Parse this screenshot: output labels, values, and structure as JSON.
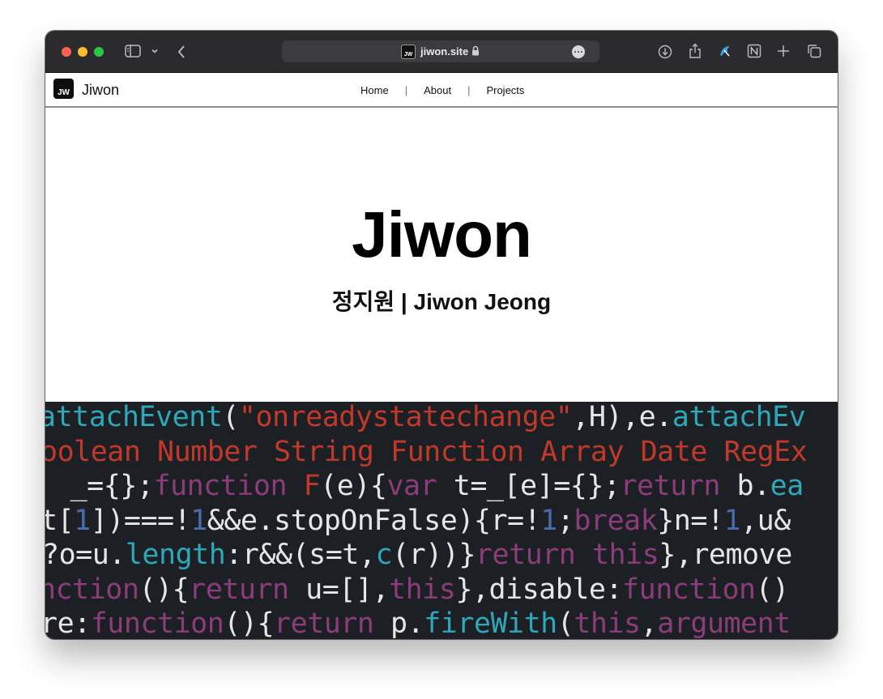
{
  "browser": {
    "url": "jiwon.site",
    "favicon_text": "JW",
    "colors": {
      "toolbar": "#2b2b2d",
      "close": "#ff5f57",
      "minimize": "#febc2e",
      "zoom": "#28c840"
    },
    "icons": [
      "sidebar-icon",
      "chevron-down-icon",
      "back-icon",
      "lock-icon",
      "more-icon",
      "download-icon",
      "share-icon",
      "extension-icon",
      "notion-icon",
      "plus-icon",
      "tabs-icon"
    ]
  },
  "site": {
    "logo_text": "JW",
    "brand": "Jiwon",
    "nav": [
      {
        "label": "Home"
      },
      {
        "label": "About"
      },
      {
        "label": "Projects"
      }
    ],
    "nav_separator": "|"
  },
  "hero": {
    "title": "Jiwon",
    "subtitle": "정지원 | Jiwon Jeong"
  },
  "code_banner": {
    "lines": [
      [
        [
          "teal",
          "attachEvent"
        ],
        [
          "white",
          "("
        ],
        [
          "red",
          "\"onreadystatechange\""
        ],
        [
          "white",
          ",H),e."
        ],
        [
          "teal",
          "attachEv"
        ]
      ],
      [
        [
          "red",
          "oolean Number String Function Array Date RegEx"
        ]
      ],
      [
        [
          "white",
          " _={};"
        ],
        [
          "purple",
          "function"
        ],
        [
          "white",
          " "
        ],
        [
          "red",
          "F"
        ],
        [
          "white",
          "(e){"
        ],
        [
          "purple",
          "var"
        ],
        [
          "white",
          " t=_[e]={};"
        ],
        [
          "purple",
          "return"
        ],
        [
          "white",
          " b."
        ],
        [
          "teal",
          "ea"
        ]
      ],
      [
        [
          "white",
          "t["
        ],
        [
          "blue",
          "1"
        ],
        [
          "white",
          "])===!"
        ],
        [
          "blue",
          "1"
        ],
        [
          "white",
          "&&e.stopOnFalse){r=!"
        ],
        [
          "blue",
          "1"
        ],
        [
          "white",
          ";"
        ],
        [
          "purple",
          "break"
        ],
        [
          "white",
          "}n=!"
        ],
        [
          "blue",
          "1"
        ],
        [
          "white",
          ",u&"
        ]
      ],
      [
        [
          "white",
          "?o=u."
        ],
        [
          "teal",
          "length"
        ],
        [
          "white",
          ":r&&(s=t,"
        ],
        [
          "teal",
          "c"
        ],
        [
          "white",
          "(r))}"
        ],
        [
          "purple",
          "return"
        ],
        [
          "white",
          " "
        ],
        [
          "purple",
          "this"
        ],
        [
          "white",
          "},remove"
        ]
      ],
      [
        [
          "purple",
          "nction"
        ],
        [
          "white",
          "(){"
        ],
        [
          "purple",
          "return"
        ],
        [
          "white",
          " u=[],"
        ],
        [
          "purple",
          "this"
        ],
        [
          "white",
          "},disable:"
        ],
        [
          "purple",
          "function"
        ],
        [
          "white",
          "()"
        ]
      ],
      [
        [
          "white",
          "re:"
        ],
        [
          "purple",
          "function"
        ],
        [
          "white",
          "(){"
        ],
        [
          "purple",
          "return"
        ],
        [
          "white",
          " p."
        ],
        [
          "teal",
          "fireWith"
        ],
        [
          "white",
          "("
        ],
        [
          "purple",
          "this"
        ],
        [
          "white",
          ","
        ],
        [
          "purple",
          "argument"
        ]
      ]
    ]
  }
}
